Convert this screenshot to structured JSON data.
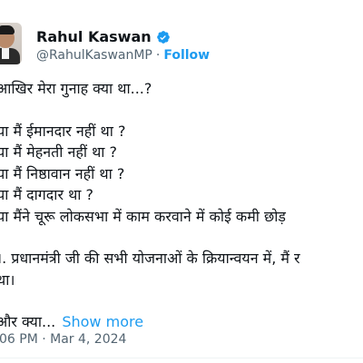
{
  "author": {
    "name": "Rahul Kaswan",
    "handle": "@RahulKaswanMP",
    "follow_label": "Follow",
    "verified_color": "#1d9bf0"
  },
  "tweet": {
    "lines": [
      "आखिर मेरा गुनाह क्या था...?",
      "",
      "या मैं ईमानदार नहीं था ?",
      "या मैं मेहनती नहीं था ?",
      "या मैं निष्ठावान नहीं था ?",
      "या मैं दागदार था ?",
      "या मैंने चूरू लोकसभा में काम करवाने में कोई कमी छोड़",
      "",
      "।. प्रधानमंत्री जी की सभी योजनाओं के क्रियान्वयन में, मैं र",
      "था।",
      "",
      "और क्या..."
    ],
    "show_more_label": "Show more",
    "timestamp": "06 PM · Mar 4, 2024"
  },
  "colors": {
    "link": "#1d9bf0",
    "secondary_text": "#536471",
    "primary_text": "#0f1419"
  }
}
